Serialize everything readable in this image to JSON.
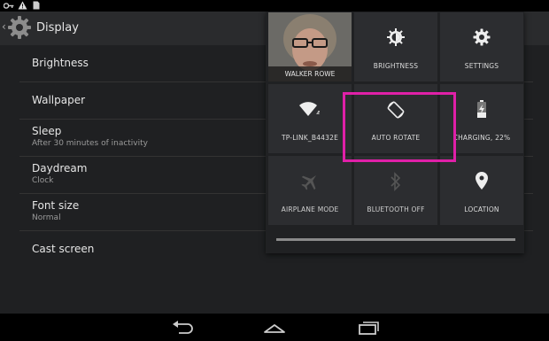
{
  "statusbar": {
    "icons": [
      "key-icon",
      "warning-icon",
      "sd-card-icon"
    ]
  },
  "header": {
    "title": "Display"
  },
  "settings": [
    {
      "title": "Brightness",
      "subtitle": ""
    },
    {
      "title": "Wallpaper",
      "subtitle": ""
    },
    {
      "title": "Sleep",
      "subtitle": "After 30 minutes of inactivity"
    },
    {
      "title": "Daydream",
      "subtitle": "Clock"
    },
    {
      "title": "Font size",
      "subtitle": "Normal"
    },
    {
      "title": "Cast screen",
      "subtitle": ""
    }
  ],
  "quick_settings": {
    "user": {
      "label": "WALKER ROWE"
    },
    "tiles": [
      {
        "label": "BRIGHTNESS",
        "icon": "brightness-icon"
      },
      {
        "label": "SETTINGS",
        "icon": "settings-gear-icon"
      },
      {
        "label": "TP-LINK_B4432E",
        "icon": "wifi-icon"
      },
      {
        "label": "AUTO ROTATE",
        "icon": "auto-rotate-icon"
      },
      {
        "label": "CHARGING, 22%",
        "icon": "battery-charging-icon"
      },
      {
        "label": "AIRPLANE MODE",
        "icon": "airplane-icon"
      },
      {
        "label": "BLUETOOTH OFF",
        "icon": "bluetooth-icon"
      },
      {
        "label": "LOCATION",
        "icon": "location-icon"
      }
    ],
    "highlight_color": "#e020a8"
  },
  "navbar": {
    "buttons": [
      "back-icon",
      "home-icon",
      "recents-icon"
    ]
  }
}
